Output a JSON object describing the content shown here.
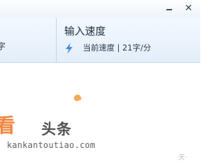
{
  "window": {
    "minimize_icon": "minimize-icon",
    "close_icon": "close-icon",
    "close_glyph": "✕"
  },
  "stats": {
    "left_partial_label": "字",
    "speed_title": "输入速度",
    "speed_icon": "lightning-icon",
    "speed_label": "当前速度 | 21字/分"
  },
  "watermark": {
    "logo_text": "看",
    "name": "头条",
    "url": "kankantoutiao.com",
    "corner_text": "天·"
  },
  "colors": {
    "panel_bg": "#e9f2fb",
    "accent_orange": "#f07a2a",
    "icon_blue": "#4a8fd6"
  }
}
